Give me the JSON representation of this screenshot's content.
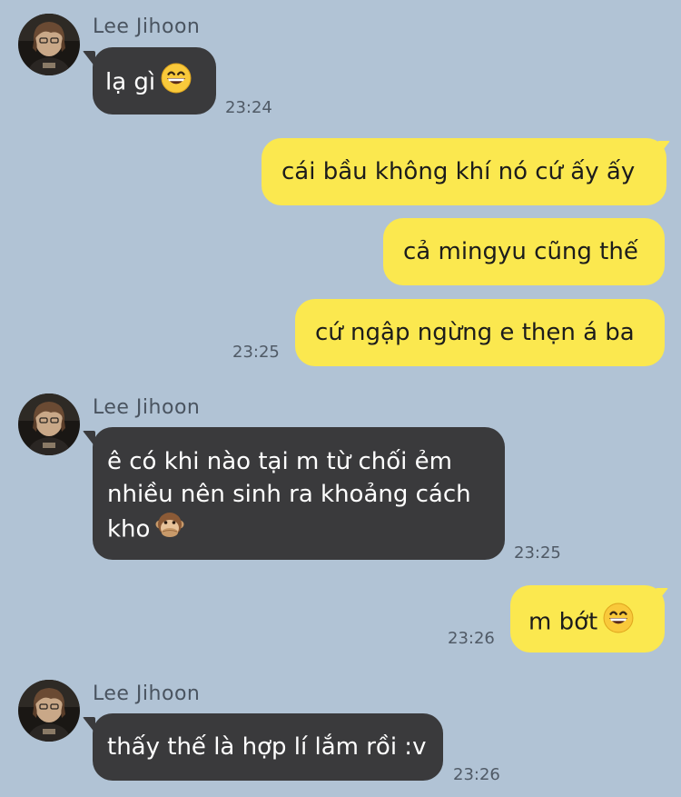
{
  "colors": {
    "background": "#b1c3d5",
    "incoming_bubble": "#3a3a3c",
    "outgoing_bubble": "#fbe84f",
    "timestamp_text": "#505a66"
  },
  "messages": [
    {
      "sender": "Lee Jihoon",
      "direction": "incoming",
      "text": "lạ gì",
      "emoji": "grinning-face",
      "time": "23:24"
    },
    {
      "direction": "outgoing",
      "text": "cái bầu không khí nó cứ ấy ấy"
    },
    {
      "direction": "outgoing",
      "text": "cả mingyu cũng thế"
    },
    {
      "direction": "outgoing",
      "text": "cứ ngập ngừng e thẹn á ba",
      "time": "23:25"
    },
    {
      "sender": "Lee Jihoon",
      "direction": "incoming",
      "lines": [
        "ê có khi nào tại m từ chối ẻm",
        "nhiều nên sinh ra khoảng cách",
        "kho"
      ],
      "emoji": "see-no-evil-monkey",
      "time": "23:25"
    },
    {
      "direction": "outgoing",
      "text": "m bớt",
      "emoji": "grinning-face",
      "time": "23:26"
    },
    {
      "sender": "Lee Jihoon",
      "direction": "incoming",
      "text": "thấy thế là hợp lí lắm rồi :v",
      "time": "23:26"
    }
  ]
}
